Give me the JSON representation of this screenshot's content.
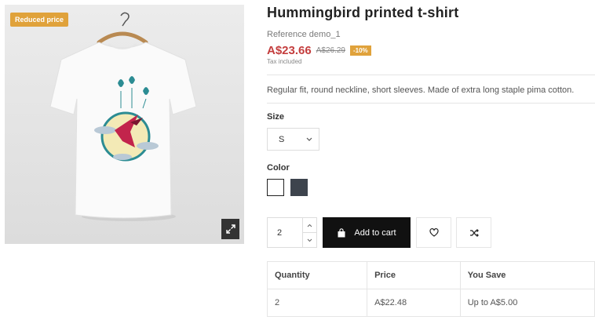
{
  "product": {
    "badge": "Reduced price",
    "title": "Hummingbird printed t-shirt",
    "reference": "Reference demo_1",
    "price": "A$23.66",
    "old_price": "A$26.29",
    "discount": "-10%",
    "tax_note": "Tax included",
    "description": "Regular fit, round neckline, short sleeves. Made of extra long staple pima cotton."
  },
  "size": {
    "label": "Size",
    "selected": "S"
  },
  "color": {
    "label": "Color",
    "swatches": [
      "#ffffff",
      "#3d444d"
    ]
  },
  "cart": {
    "quantity": "2",
    "add_label": "Add to cart"
  },
  "discount_table": {
    "headers": [
      "Quantity",
      "Price",
      "You Save"
    ],
    "rows": [
      [
        "2",
        "A$22.48",
        "Up to A$5.00"
      ]
    ]
  },
  "icons": {
    "expand": "expand-icon",
    "bag": "shopping-bag-icon",
    "wishlist": "heart-icon",
    "compare": "shuffle-icon",
    "select": "chevron-down-icon",
    "qty_up": "chevron-up-icon",
    "qty_down": "chevron-down-icon"
  }
}
